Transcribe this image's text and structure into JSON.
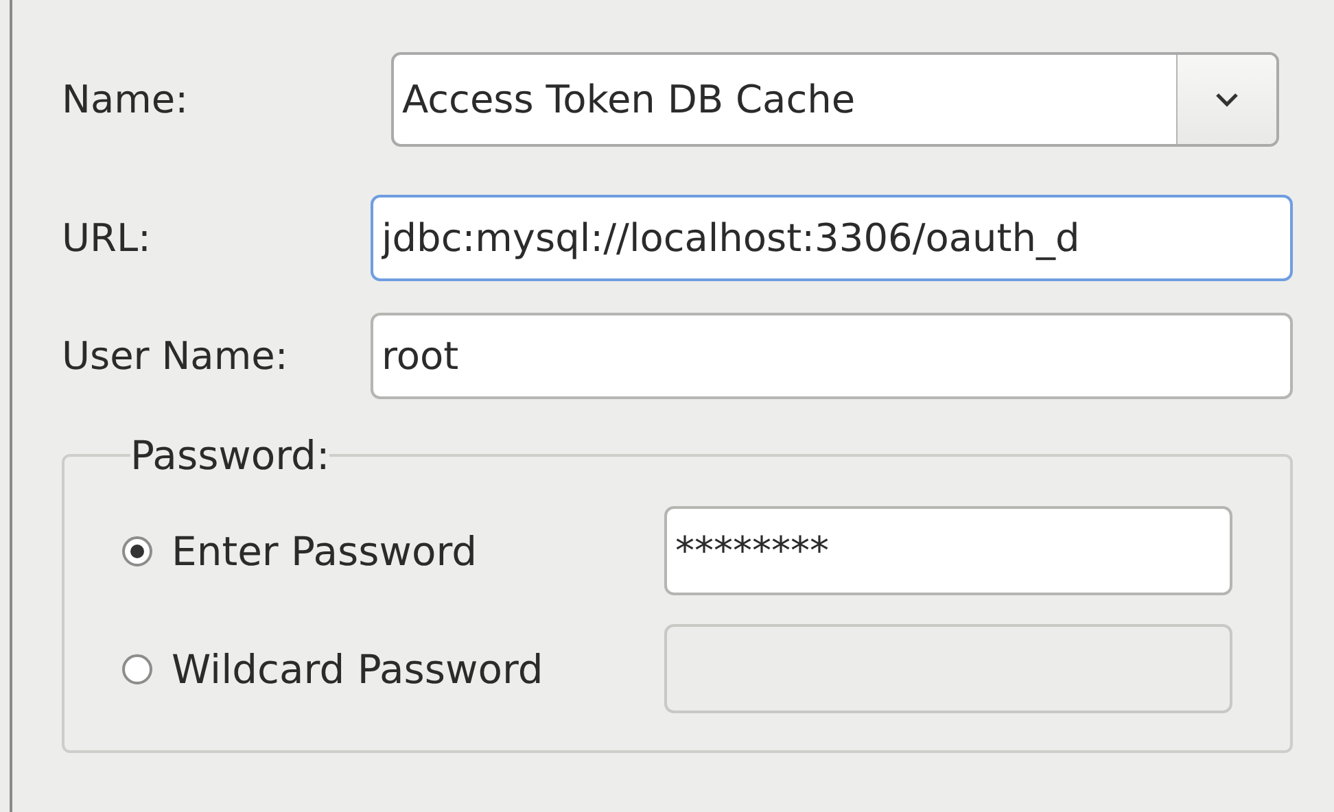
{
  "name": {
    "label": "Name:",
    "value": "Access Token DB Cache"
  },
  "url": {
    "label": "URL:",
    "value": "jdbc:mysql://localhost:3306/oauth_d",
    "focused": true
  },
  "user_name": {
    "label": "User Name:",
    "value": "root",
    "focused": false
  },
  "password": {
    "title": "Password:",
    "options": [
      {
        "label": "Enter Password",
        "selected": true,
        "value": "********",
        "field_disabled": false
      },
      {
        "label": "Wildcard Password",
        "selected": false,
        "field_disabled": true
      }
    ]
  }
}
